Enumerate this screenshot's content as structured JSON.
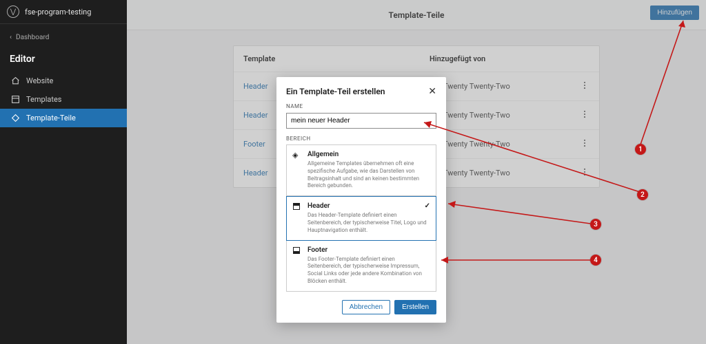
{
  "site": {
    "name": "fse-program-testing"
  },
  "sidebar": {
    "back_label": "Dashboard",
    "heading": "Editor",
    "items": [
      {
        "label": "Website"
      },
      {
        "label": "Templates"
      },
      {
        "label": "Template-Teile"
      }
    ]
  },
  "topbar": {
    "title": "Template-Teile",
    "add_label": "Hinzufügen"
  },
  "table": {
    "col_template": "Template",
    "col_added_by": "Hinzugefügt von",
    "rows": [
      {
        "name": "Header",
        "theme": "Twenty Twenty-Two"
      },
      {
        "name": "Header",
        "theme": "Twenty Twenty-Two"
      },
      {
        "name": "Footer",
        "theme": "Twenty Twenty-Two"
      },
      {
        "name": "Header",
        "theme": "Twenty Twenty-Two"
      }
    ]
  },
  "modal": {
    "title": "Ein Template-Teil erstellen",
    "name_label": "NAME",
    "name_value": "mein neuer Header",
    "area_label": "BEREICH",
    "areas": [
      {
        "title": "Allgemein",
        "desc": "Allgemeine Templates übernehmen oft eine spezifische Aufgabe, wie das Darstellen von Beitragsinhalt und sind an keinen bestimmten Bereich gebunden."
      },
      {
        "title": "Header",
        "desc": "Das Header-Template definiert einen Seitenbereich, der typischerweise Titel, Logo und Hauptnavigation enthält."
      },
      {
        "title": "Footer",
        "desc": "Das Footer-Template definiert einen Seitenbereich, der typischerweise Impressum, Social Links oder jede andere Kombination von Blöcken enthält."
      }
    ],
    "cancel_label": "Abbrechen",
    "create_label": "Erstellen"
  },
  "annotations": [
    "1",
    "2",
    "3",
    "4"
  ]
}
